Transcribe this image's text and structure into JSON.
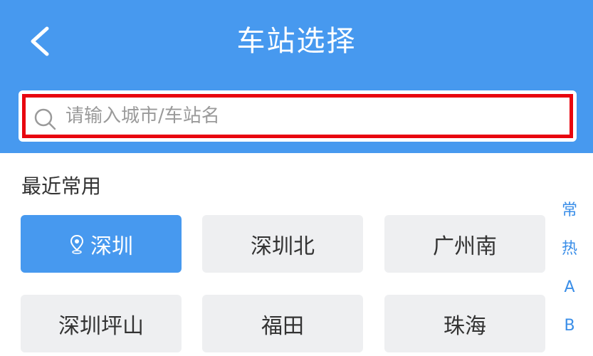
{
  "header": {
    "title": "车站选择",
    "background": "#4799ef"
  },
  "search": {
    "placeholder": "请输入城市/车站名",
    "value": "",
    "highlight_color": "#e8050f"
  },
  "recent": {
    "section_title": "最近常用",
    "items": [
      {
        "label": "深圳",
        "selected": true,
        "icon": "location-pin-icon"
      },
      {
        "label": "深圳北",
        "selected": false
      },
      {
        "label": "广州南",
        "selected": false
      },
      {
        "label": "深圳坪山",
        "selected": false
      },
      {
        "label": "福田",
        "selected": false
      },
      {
        "label": "珠海",
        "selected": false
      }
    ]
  },
  "index_bar": {
    "items": [
      "常",
      "热",
      "A",
      "B"
    ],
    "color": "#3a8ee8"
  }
}
